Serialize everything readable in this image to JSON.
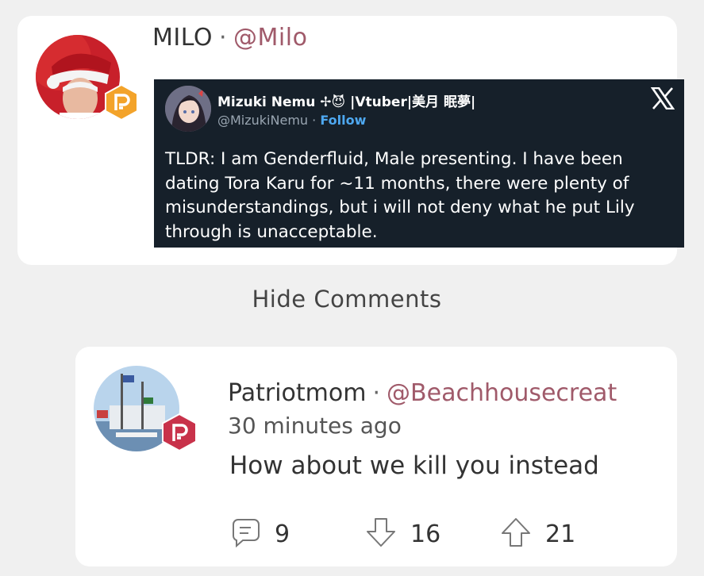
{
  "post": {
    "author_name": "MILO",
    "separator": "·",
    "author_handle": "@Milo"
  },
  "tweet": {
    "display_name": "Mizuki Nemu ✢😈 |Vtuber|美月 眠夢|",
    "handle": "@MizukiNemu",
    "dot": "·",
    "follow_label": "Follow",
    "text": "TLDR: I am Genderfluid, Male presenting. I have been dating Tora Karu for ~11 months, there were plenty of misunderstandings, but i will not deny what he put Lily through is unacceptable."
  },
  "comments_toggle": {
    "label": "Hide Comments"
  },
  "comment": {
    "author_name": "Patriotmom",
    "separator": "·",
    "author_handle": "@Beachhousecreat",
    "timestamp": "30 minutes ago",
    "body": "How about we kill you instead",
    "replies_count": "9",
    "downvotes_count": "16",
    "upvotes_count": "21"
  },
  "colors": {
    "parler_badge_orange": "#f3a32a",
    "parler_badge_red": "#c8324a",
    "handle_color": "#a05a6a",
    "tweet_bg": "#16202a",
    "follow_blue": "#4ea8f0"
  },
  "icons": [
    "parler-badge-icon",
    "x-logo-icon",
    "reply-icon",
    "downvote-icon",
    "upvote-icon"
  ]
}
